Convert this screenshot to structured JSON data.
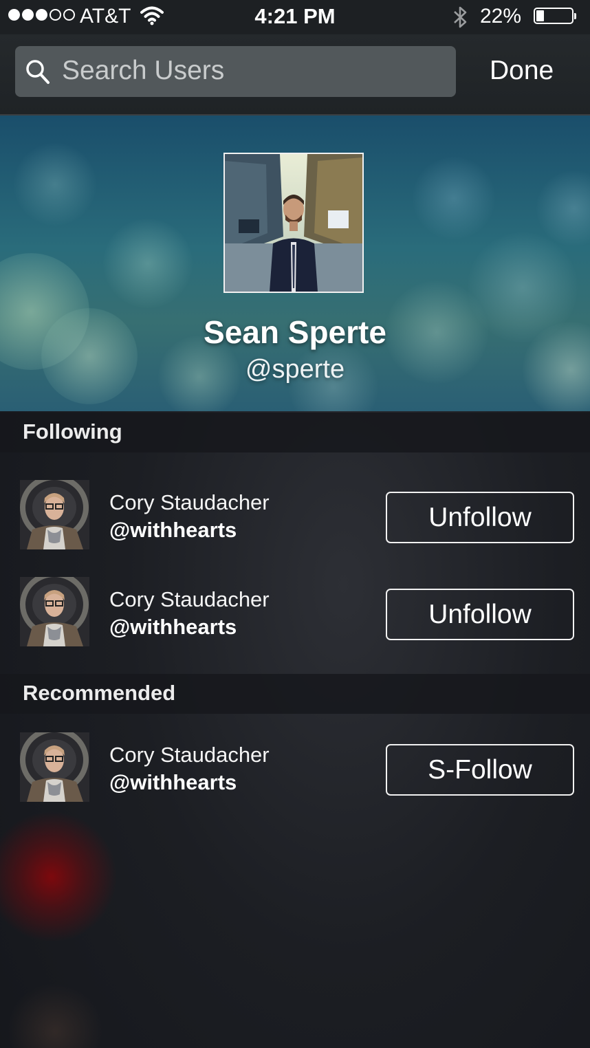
{
  "status_bar": {
    "carrier": "AT&T",
    "time": "4:21 PM",
    "battery_percent": "22%",
    "battery_level": 0.22,
    "signal_bars": 3,
    "icons": [
      "signal-icon",
      "wifi-icon",
      "bluetooth-icon",
      "battery-icon"
    ]
  },
  "search": {
    "placeholder": "Search Users",
    "done_label": "Done"
  },
  "profile": {
    "name": "Sean Sperte",
    "handle": "@sperte"
  },
  "sections": {
    "following": {
      "title": "Following",
      "users": [
        {
          "name": "Cory Staudacher",
          "handle": "@withhearts",
          "action": "Unfollow"
        },
        {
          "name": "Cory Staudacher",
          "handle": "@withhearts",
          "action": "Unfollow"
        }
      ]
    },
    "recommended": {
      "title": "Recommended",
      "users": [
        {
          "name": "Cory Staudacher",
          "handle": "@withhearts",
          "action": "S-Follow"
        }
      ]
    }
  },
  "colors": {
    "banner": "#2a6c7b",
    "background": "#1c1e23",
    "search_field": "#52585b"
  }
}
